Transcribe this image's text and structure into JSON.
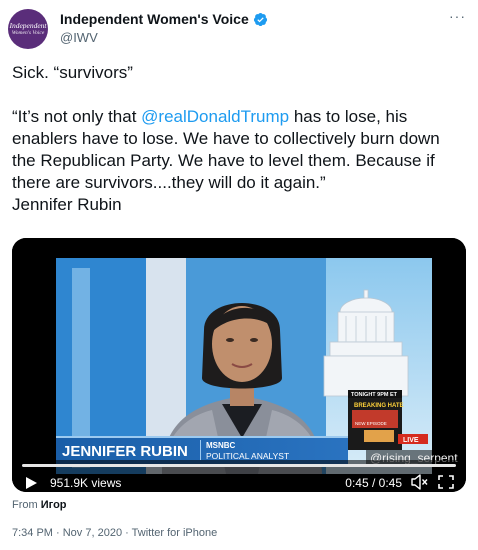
{
  "author": {
    "avatar_line1": "Independent",
    "avatar_line2": "Women's Voice",
    "display_name": "Independent Women's Voice",
    "handle": "@IWV",
    "verified": true
  },
  "more_label": "···",
  "tweet": {
    "line1": "Sick. “survivors”",
    "quote_open": "“It’s not only that ",
    "mention": "@realDonaldTrump",
    "quote_rest": " has to lose, his enablers have to lose. We have to collectively burn down the Republican Party. We have to level them. Because if there are survivors....they will do it again.”",
    "attribution": "Jennifer Rubin"
  },
  "video": {
    "lower_third_name": "JENNIFER RUBIN",
    "network": "MSNBC",
    "lower_third_title": "POLITICAL ANALYST",
    "promo_top": "TONIGHT 9PM ET",
    "promo_title": "BREAKING HATE",
    "promo_sub": "NEW EPISODE",
    "promo_live": "LIVE",
    "watermark": "@rising_serpent",
    "views": "951.9K views",
    "time": "0:45 / 0:45",
    "progress": 1.0
  },
  "from": {
    "label": "From",
    "name": "Игор"
  },
  "meta": "7:34 PM · Nov 7, 2020 · Twitter for iPhone",
  "colors": {
    "link": "#1d9bf0",
    "verified": "#1d9bf0",
    "avatar": "#5a2d7a"
  }
}
